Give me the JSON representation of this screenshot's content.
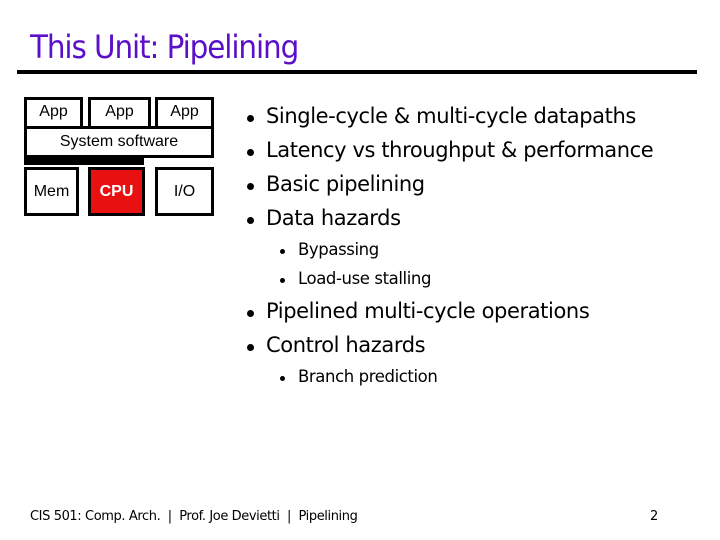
{
  "slide": {
    "title": "This Unit: Pipelining",
    "title_color": "#5a10c8",
    "diagram": {
      "apps": [
        "App",
        "App",
        "App"
      ],
      "system_software": "System software",
      "hardware": {
        "mem": "Mem",
        "cpu": "CPU",
        "io": "I/O"
      },
      "highlight_color": "#e81010"
    },
    "bullets": [
      {
        "text": "Single-cycle & multi-cycle datapaths",
        "level": 1
      },
      {
        "text": "Latency vs throughput & performance",
        "level": 1
      },
      {
        "text": "Basic pipelining",
        "level": 1
      },
      {
        "text": "Data hazards",
        "level": 1
      },
      {
        "text": "Bypassing",
        "level": 2
      },
      {
        "text": "Load-use stalling",
        "level": 2
      },
      {
        "text": "Pipelined multi-cycle operations",
        "level": 1
      },
      {
        "text": "Control hazards",
        "level": 1
      },
      {
        "text": "Branch prediction",
        "level": 2
      }
    ],
    "footer": {
      "text": "CIS 501: Comp. Arch.  |  Prof. Joe Devietti  |  Pipelining",
      "page_number": "2"
    }
  }
}
